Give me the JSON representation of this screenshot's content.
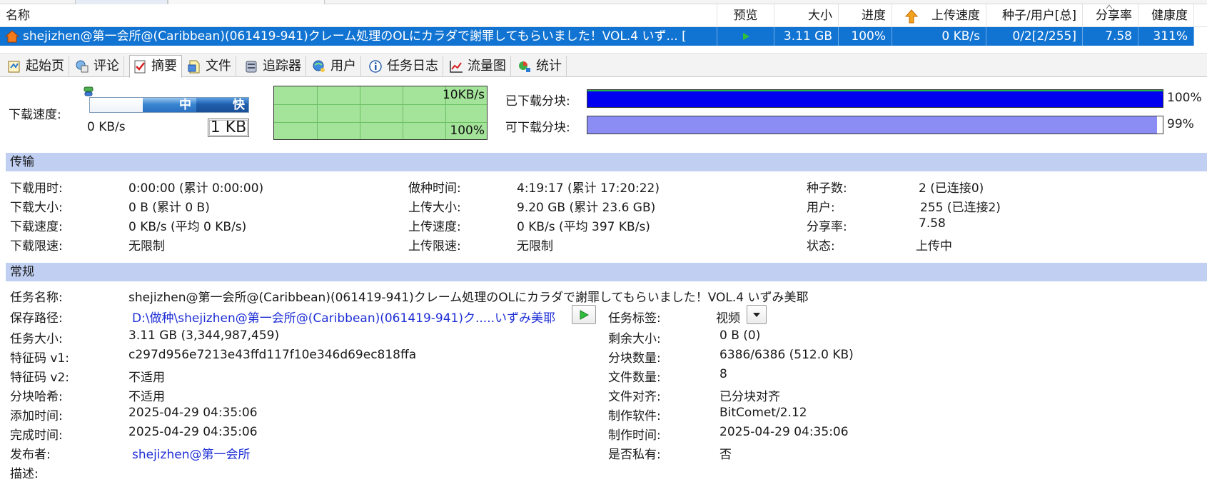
{
  "list": {
    "columns": {
      "name": "名称",
      "preview": "预览",
      "size": "大小",
      "progress": "进度",
      "upload_speed": "上传速度",
      "seeds_peers": "种子/用户[总]",
      "ratio": "分享率",
      "health": "健康度"
    },
    "row": {
      "name": "shejizhen@第一会所@(Caribbean)(061419-941)クレーム処理のOLにカラダで謝罪してもらいました！VOL.4 いず... [",
      "size": "3.11 GB",
      "progress": "100%",
      "upload_speed": "0 KB/s",
      "seeds_peers": "0/2[2/255]",
      "ratio": "7.58",
      "health": "311%"
    }
  },
  "tabs": [
    {
      "label": "起始页",
      "icon": "start-page-icon"
    },
    {
      "label": "评论",
      "icon": "comment-icon"
    },
    {
      "label": "摘要",
      "icon": "summary-icon"
    },
    {
      "label": "文件",
      "icon": "file-icon"
    },
    {
      "label": "追踪器",
      "icon": "tracker-icon"
    },
    {
      "label": "用户",
      "icon": "users-icon"
    },
    {
      "label": "任务日志",
      "icon": "info-icon"
    },
    {
      "label": "流量图",
      "icon": "chart-icon"
    },
    {
      "label": "统计",
      "icon": "stats-icon"
    }
  ],
  "speed": {
    "label": "下载速度:",
    "current": "0 KB/s",
    "slider_mid": "中",
    "slider_fast": "快",
    "limit": "1 KB",
    "graph_max": "10KB/s",
    "graph_pct": "100%"
  },
  "pieces": {
    "downloaded_label": "已下载分块:",
    "downloaded_pct": "100%",
    "downloaded_value": 100,
    "available_label": "可下载分块:",
    "available_pct": "99%",
    "available_value": 99
  },
  "transfer": {
    "title": "传输",
    "col1": [
      {
        "k": "下载用时:",
        "v": "0:00:00 (累计 0:00:00)"
      },
      {
        "k": "下载大小:",
        "v": "0 B (累计 0 B)"
      },
      {
        "k": "下载速度:",
        "v": "0 KB/s (平均 0 KB/s)"
      },
      {
        "k": "下载限速:",
        "v": "无限制"
      }
    ],
    "col2": [
      {
        "k": "做种时间:",
        "v": "4:19:17 (累计 17:20:22)"
      },
      {
        "k": "上传大小:",
        "v": "9.20 GB (累计 23.6 GB)"
      },
      {
        "k": "上传速度:",
        "v": "0 KB/s (平均 397 KB/s)"
      },
      {
        "k": "上传限速:",
        "v": "无限制"
      }
    ],
    "col3": [
      {
        "k": "种子数:",
        "v": "2 (已连接0)"
      },
      {
        "k": "用户:",
        "v": "255 (已连接2)"
      },
      {
        "k": "分享率:",
        "v": "7.58"
      },
      {
        "k": "状态:",
        "v": "上传中"
      }
    ]
  },
  "general": {
    "title": "常规",
    "task_name_label": "任务名称:",
    "task_name": "shejizhen@第一会所@(Caribbean)(061419-941)クレーム処理のOLにカラダで謝罪してもらいました！VOL.4 いずみ美耶",
    "save_path_label": "保存路径:",
    "save_path": "D:\\做种\\shejizhen@第一会所@(Caribbean)(061419-941)ク.....いずみ美耶",
    "tag_label": "任务标签:",
    "tag_value": "视频",
    "left": [
      {
        "k": "任务大小:",
        "v": "3.11 GB (3,344,987,459)"
      },
      {
        "k": "特征码 v1:",
        "v": "c297d956e7213e43ffd117f10e346d69ec818ffa"
      },
      {
        "k": "特征码 v2:",
        "v": "不适用"
      },
      {
        "k": "分块哈希:",
        "v": "不适用"
      },
      {
        "k": "添加时间:",
        "v": "2025-04-29 04:35:06"
      },
      {
        "k": "完成时间:",
        "v": "2025-04-29 04:35:06"
      }
    ],
    "right": [
      {
        "k": "剩余大小:",
        "v": "0 B (0)"
      },
      {
        "k": "分块数量:",
        "v": "6386/6386 (512.0 KB)"
      },
      {
        "k": "文件数量:",
        "v": "8"
      },
      {
        "k": "文件对齐:",
        "v": "已分块对齐"
      },
      {
        "k": "制作软件:",
        "v": "BitComet/2.12"
      },
      {
        "k": "制作时间:",
        "v": "2025-04-29 04:35:06"
      },
      {
        "k": "是否私有:",
        "v": "否"
      }
    ],
    "publisher_label": "发布者:",
    "publisher": "shejizhen@第一会所",
    "description_label": "描述:"
  },
  "colors": {
    "selection": "#1274d2",
    "section_header": "#c0cff2",
    "downloaded_bar": "#0000f0",
    "available_bar": "#8c8cf5",
    "graph_bg": "#a4e39a",
    "link": "#1f2fd6"
  }
}
